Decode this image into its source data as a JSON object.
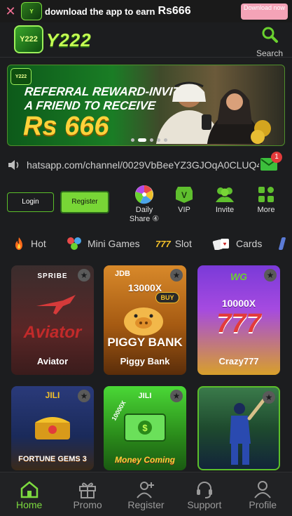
{
  "download_bar": {
    "text": "download the app to earn",
    "amount": "Rs666",
    "button_label": "Download now"
  },
  "header": {
    "logo_text": "Y222",
    "search_label": "Search"
  },
  "hero": {
    "line1": "REFERRAL REWARD-INVITE",
    "line2": "A FRIEND TO RECEIVE",
    "amount": "Rs 666",
    "slides": 5,
    "active_slide": 1
  },
  "marquee": {
    "text": "hatsapp.com/channel/0029VbBeeYZ3GJOqA0CLUQ43",
    "mail_count": "1"
  },
  "actions": {
    "login_label": "Login",
    "register_label": "Register",
    "quick": [
      {
        "icon": "wheel-icon",
        "label": "Daily Share ④"
      },
      {
        "icon": "vip-icon",
        "label": "VIP"
      },
      {
        "icon": "invite-icon",
        "label": "Invite"
      },
      {
        "icon": "more-icon",
        "label": "More"
      }
    ]
  },
  "tabs": [
    {
      "icon": "flame-icon",
      "label": "Hot"
    },
    {
      "icon": "balls-icon",
      "label": "Mini Games"
    },
    {
      "icon": "slot-777-icon",
      "label": "Slot"
    },
    {
      "icon": "cards-icon",
      "label": "Cards"
    }
  ],
  "games": [
    {
      "name": "Aviator",
      "provider": "SPRIBE",
      "art": "Aviator"
    },
    {
      "name": "Piggy Bank",
      "provider": "JDB",
      "art": "PIGGY BANK",
      "multiplier": "13000X",
      "badge": "BUY"
    },
    {
      "name": "Crazy777",
      "provider": "WG",
      "art": "777",
      "multiplier": "10000X"
    },
    {
      "name": "",
      "provider": "JILI",
      "art": "FORTUNE GEMS 3"
    },
    {
      "name": "",
      "provider": "JILI",
      "art": "Money Coming",
      "multiplier": "10000X"
    },
    {
      "name": "",
      "provider": "",
      "art": "cricket"
    }
  ],
  "bottom_nav": [
    {
      "icon": "home-icon",
      "label": "Home",
      "active": true
    },
    {
      "icon": "gift-icon",
      "label": "Promo"
    },
    {
      "icon": "add-user-icon",
      "label": "Register"
    },
    {
      "icon": "headset-icon",
      "label": "Support"
    },
    {
      "icon": "person-icon",
      "label": "Profile"
    }
  ],
  "colors": {
    "accent": "#78d636",
    "background": "#1c1d1f",
    "download_button": "#f4a3b7"
  }
}
